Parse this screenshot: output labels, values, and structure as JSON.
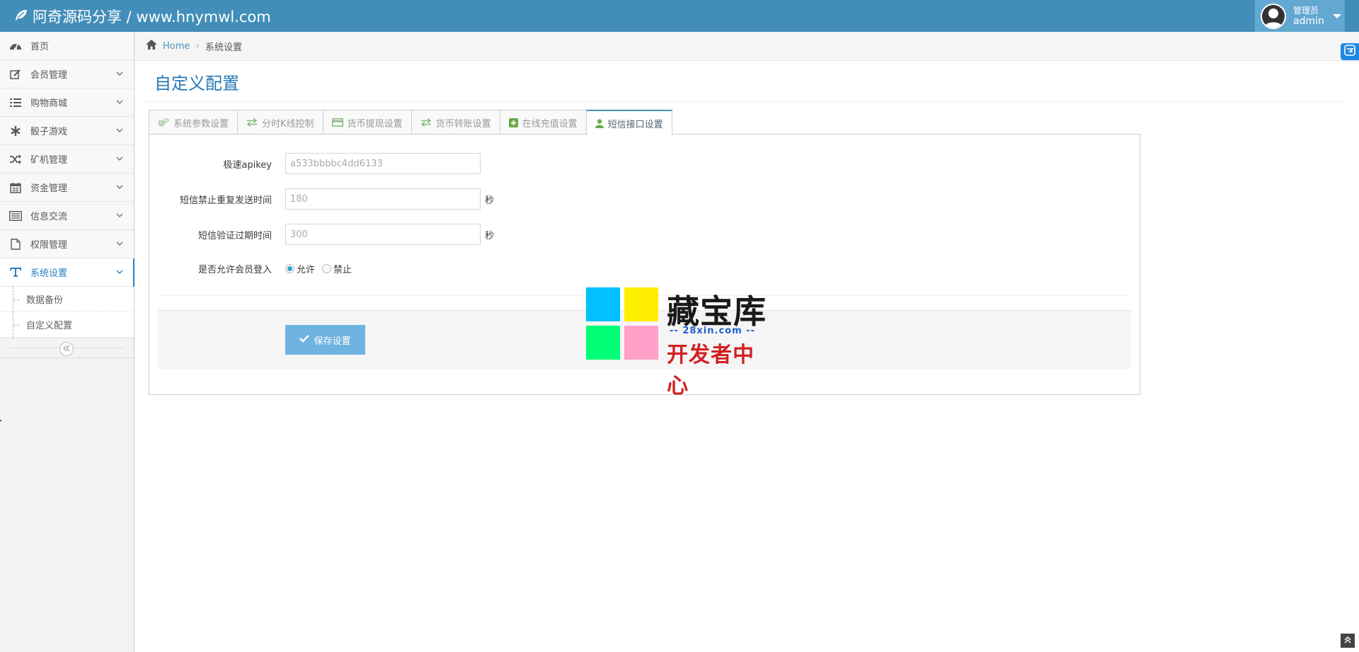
{
  "header": {
    "brand": "阿奇源码分享 / www.hnymwl.com",
    "user_role": "管理员",
    "user_name": "admin"
  },
  "sidebar": {
    "items": [
      {
        "label": "首页",
        "icon": "dashboard-icon"
      },
      {
        "label": "会员管理",
        "icon": "edit-icon"
      },
      {
        "label": "购物商城",
        "icon": "list-icon"
      },
      {
        "label": "骰子游戏",
        "icon": "asterisk-icon"
      },
      {
        "label": "矿机管理",
        "icon": "shuffle-icon"
      },
      {
        "label": "资金管理",
        "icon": "calendar-icon"
      },
      {
        "label": "信息交流",
        "icon": "list-alt-icon"
      },
      {
        "label": "权限管理",
        "icon": "file-icon"
      },
      {
        "label": "系统设置",
        "icon": "text-width-icon"
      }
    ],
    "subitems": [
      "数据备份",
      "自定义配置"
    ]
  },
  "breadcrumb": {
    "home": "Home",
    "current": "系统设置"
  },
  "page": {
    "title": "自定义配置"
  },
  "tabs": [
    {
      "label": "系统参数设置",
      "icon": "cogs-icon"
    },
    {
      "label": "分时K线控制",
      "icon": "exchange-icon"
    },
    {
      "label": "货币提现设置",
      "icon": "credit-card-icon"
    },
    {
      "label": "货币转账设置",
      "icon": "exchange-icon"
    },
    {
      "label": "在线充值设置",
      "icon": "plus-square-icon"
    },
    {
      "label": "短信接口设置",
      "icon": "user-icon"
    }
  ],
  "form": {
    "apikey_label": "极速apikey",
    "apikey_placeholder": "a533bbbbc4dd6133",
    "resend_label": "短信禁止重复发送时间",
    "resend_placeholder": "180",
    "resend_unit": "秒",
    "expire_label": "短信验证过期时间",
    "expire_placeholder": "300",
    "expire_unit": "秒",
    "login_label": "是否允许会员登入",
    "allow_label": "允许",
    "deny_label": "禁止",
    "save_label": "保存设置"
  },
  "watermark": {
    "title": "藏宝库",
    "url": "-- 28xin.com --",
    "subtitle": "开发者中心"
  },
  "colors": {
    "navbar": "#438eb9",
    "accent": "#2679b5",
    "button": "#6fb3e0"
  }
}
